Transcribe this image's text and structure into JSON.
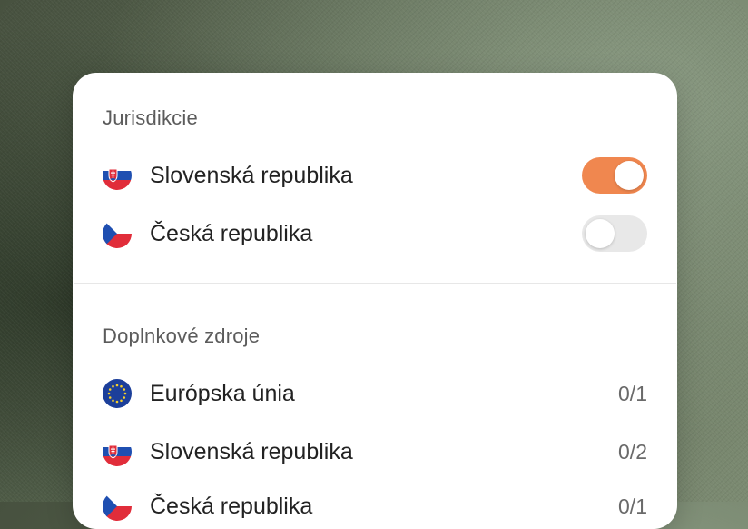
{
  "jurisdictions": {
    "title": "Jurisdikcie",
    "items": [
      {
        "label": "Slovenská republika",
        "flag": "slovakia-flag-icon",
        "enabled": true
      },
      {
        "label": "Česká republika",
        "flag": "czech-flag-icon",
        "enabled": false
      }
    ]
  },
  "additional_sources": {
    "title": "Doplnkové zdroje",
    "items": [
      {
        "label": "Európska únia",
        "flag": "eu-flag-icon",
        "count": "0/1"
      },
      {
        "label": "Slovenská republika",
        "flag": "slovakia-flag-icon",
        "count": "0/2"
      },
      {
        "label": "Česká republika",
        "flag": "czech-flag-icon",
        "count": "0/1"
      }
    ]
  },
  "colors": {
    "toggle_on": "#f0874f",
    "toggle_off": "#e8e8e8",
    "eu_blue": "#1c3f9a",
    "eu_star": "#f5cf2b",
    "sk_blue": "#1f4fb1",
    "sk_red": "#e12d3a",
    "cz_blue": "#1f4fb1",
    "cz_red": "#e12d3a"
  }
}
